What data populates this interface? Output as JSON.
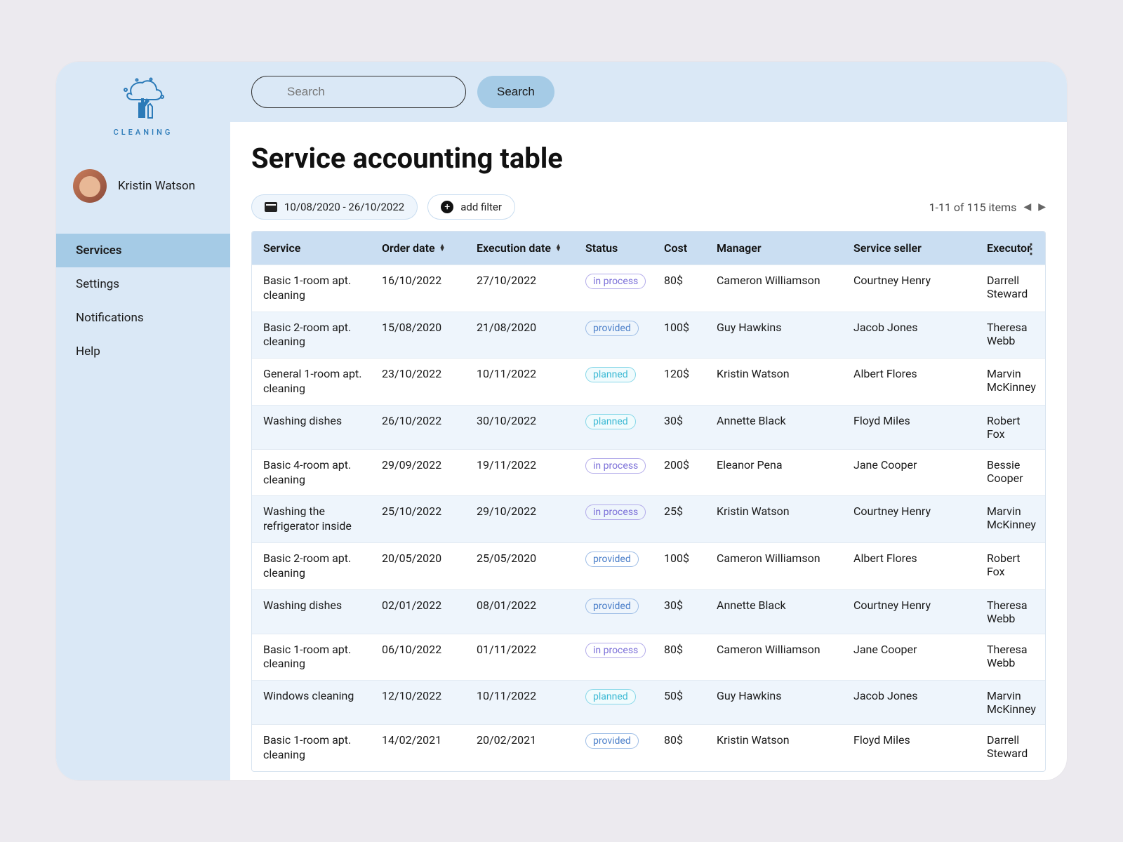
{
  "brand": {
    "name": "CLEANING"
  },
  "user": {
    "name": "Kristin Watson"
  },
  "nav": {
    "items": [
      {
        "label": "Services",
        "active": true
      },
      {
        "label": "Settings",
        "active": false
      },
      {
        "label": "Notifications",
        "active": false
      },
      {
        "label": "Help",
        "active": false
      }
    ]
  },
  "search": {
    "placeholder": "Search",
    "button": "Search"
  },
  "page": {
    "title": "Service accounting table"
  },
  "filters": {
    "date_range": "10/08/2020 - 26/10/2022",
    "add_filter": "add filter"
  },
  "pagination": {
    "summary": "1-11 of 115 items"
  },
  "table": {
    "columns": {
      "service": "Service",
      "order_date": "Order date",
      "execution_date": "Execution date",
      "status": "Status",
      "cost": "Cost",
      "manager": "Manager",
      "service_seller": "Service seller",
      "executor": "Executor"
    },
    "rows": [
      {
        "service": "Basic 1-room apt. cleaning",
        "order_date": "16/10/2022",
        "execution_date": "27/10/2022",
        "status": "in process",
        "status_kind": "in-process",
        "cost": "80$",
        "manager": "Cameron Williamson",
        "seller": "Courtney Henry",
        "executor": "Darrell Steward"
      },
      {
        "service": "Basic 2-room apt. cleaning",
        "order_date": "15/08/2020",
        "execution_date": "21/08/2020",
        "status": "provided",
        "status_kind": "provided",
        "cost": "100$",
        "manager": "Guy Hawkins",
        "seller": "Jacob Jones",
        "executor": "Theresa Webb"
      },
      {
        "service": "General 1-room apt. cleaning",
        "order_date": "23/10/2022",
        "execution_date": "10/11/2022",
        "status": "planned",
        "status_kind": "planned",
        "cost": "120$",
        "manager": "Kristin Watson",
        "seller": "Albert Flores",
        "executor": "Marvin McKinney"
      },
      {
        "service": "Washing dishes",
        "order_date": "26/10/2022",
        "execution_date": "30/10/2022",
        "status": "planned",
        "status_kind": "planned",
        "cost": "30$",
        "manager": "Annette Black",
        "seller": "Floyd Miles",
        "executor": "Robert Fox"
      },
      {
        "service": "Basic 4-room apt. cleaning",
        "order_date": "29/09/2022",
        "execution_date": "19/11/2022",
        "status": "in process",
        "status_kind": "in-process",
        "cost": "200$",
        "manager": "Eleanor Pena",
        "seller": "Jane Cooper",
        "executor": "Bessie Cooper"
      },
      {
        "service": "Washing the refrigerator inside",
        "order_date": "25/10/2022",
        "execution_date": "29/10/2022",
        "status": "in process",
        "status_kind": "in-process",
        "cost": "25$",
        "manager": "Kristin Watson",
        "seller": "Courtney Henry",
        "executor": "Marvin McKinney"
      },
      {
        "service": "Basic 2-room apt. cleaning",
        "order_date": "20/05/2020",
        "execution_date": "25/05/2020",
        "status": "provided",
        "status_kind": "provided",
        "cost": "100$",
        "manager": "Cameron Williamson",
        "seller": "Albert Flores",
        "executor": "Robert Fox"
      },
      {
        "service": "Washing dishes",
        "order_date": "02/01/2022",
        "execution_date": "08/01/2022",
        "status": "provided",
        "status_kind": "provided",
        "cost": "30$",
        "manager": "Annette Black",
        "seller": "Courtney Henry",
        "executor": "Theresa Webb"
      },
      {
        "service": "Basic 1-room apt. cleaning",
        "order_date": "06/10/2022",
        "execution_date": "01/11/2022",
        "status": "in process",
        "status_kind": "in-process",
        "cost": "80$",
        "manager": "Cameron Williamson",
        "seller": "Jane Cooper",
        "executor": "Theresa Webb"
      },
      {
        "service": "Windows cleaning",
        "order_date": "12/10/2022",
        "execution_date": "10/11/2022",
        "status": "planned",
        "status_kind": "planned",
        "cost": "50$",
        "manager": "Guy Hawkins",
        "seller": "Jacob Jones",
        "executor": "Marvin McKinney"
      },
      {
        "service": "Basic 1-room apt. cleaning",
        "order_date": "14/02/2021",
        "execution_date": "20/02/2021",
        "status": "provided",
        "status_kind": "provided",
        "cost": "80$",
        "manager": "Kristin Watson",
        "seller": "Floyd Miles",
        "executor": "Darrell Steward"
      }
    ]
  }
}
